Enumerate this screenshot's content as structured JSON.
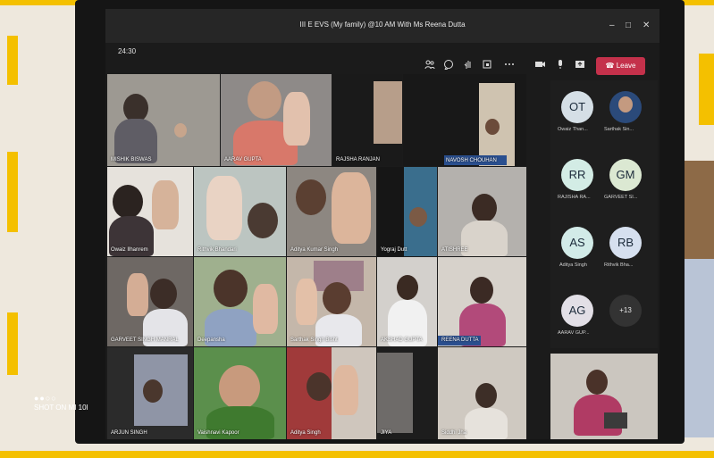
{
  "window": {
    "title": "III E EVS (My family) @10 AM With Ms Reena Dutta",
    "minimize": "–",
    "maximize": "□",
    "close": "✕"
  },
  "call": {
    "timer": "24:30",
    "leave_label": "Leave",
    "leave_color": "#c4314b"
  },
  "toolbar": {
    "icons": [
      "people-icon",
      "chat-icon",
      "raise-hand-icon",
      "rooms-icon",
      "more-icon",
      "camera-icon",
      "mic-icon",
      "share-icon"
    ]
  },
  "participants": [
    {
      "name": "MISHIK BISWAS"
    },
    {
      "name": "AARAV GUPTA"
    },
    {
      "name": "RAJSHA RANJAN"
    },
    {
      "name": "NAVOSH CHOUHAN"
    },
    {
      "name": "Owaiz Ilhanrem"
    },
    {
      "name": "Rithvik Bhandari"
    },
    {
      "name": "Aditya Kumar Singh"
    },
    {
      "name": "Yograj Dutt"
    },
    {
      "name": "ATISHREE"
    },
    {
      "name": "GARVEET SINGH MANRAL"
    },
    {
      "name": "Deepansha"
    },
    {
      "name": "Sarthak Singh Bisht"
    },
    {
      "name": "AKSHAD GUPTA"
    },
    {
      "name": "REENA DUTTA"
    },
    {
      "name": "ARJUN SINGH"
    },
    {
      "name": "Vaishnavi Kapoor"
    },
    {
      "name": "Aditya Singh"
    },
    {
      "name": "JIYA"
    },
    {
      "name": "Siddhi Jha"
    }
  ],
  "roster": [
    {
      "initials": "OT",
      "label": "Owaiz Than..."
    },
    {
      "initials": "",
      "label": "Sarthak Sin..."
    },
    {
      "initials": "RR",
      "label": "RAJISHA RA..."
    },
    {
      "initials": "GM",
      "label": "GARVEET SI..."
    },
    {
      "initials": "AS",
      "label": "Aditya Singh"
    },
    {
      "initials": "RB",
      "label": "Rithvik Bha..."
    },
    {
      "initials": "AG",
      "label": "AARAV GUP..."
    },
    {
      "initials": "+13",
      "label": ""
    }
  ],
  "photo": {
    "watermark": "SHOT ON MI 10I",
    "dots": "●●○○"
  }
}
